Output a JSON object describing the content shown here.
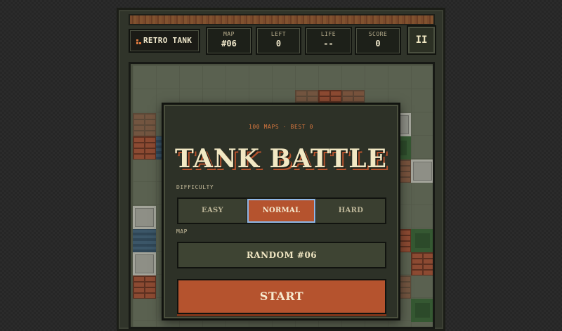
{
  "app": {
    "logo_text": "RETRO TANK"
  },
  "hud": [
    {
      "label": "MAP",
      "value": "#06"
    },
    {
      "label": "LEFT",
      "value": "0"
    },
    {
      "label": "LIFE",
      "value": "--"
    },
    {
      "label": "SCORE",
      "value": "0"
    }
  ],
  "pause": {
    "label": "II"
  },
  "menu": {
    "subtitle": "100 MAPS · BEST 0",
    "title": "TANK BATTLE",
    "difficulty_label": "DIFFICULTY",
    "difficulties": [
      "EASY",
      "NORMAL",
      "HARD"
    ],
    "selected_difficulty": "NORMAL",
    "map_label": "MAP",
    "map_value": "RANDOM #06",
    "start_label": "START"
  },
  "colors": {
    "accent": "#b5532e",
    "subtitle": "#d9783f",
    "text": "#f2e8c4",
    "focus_ring": "#8fb7e6"
  },
  "icons": {
    "pause": "pause-icon",
    "logo": "tank-logo-icon"
  }
}
